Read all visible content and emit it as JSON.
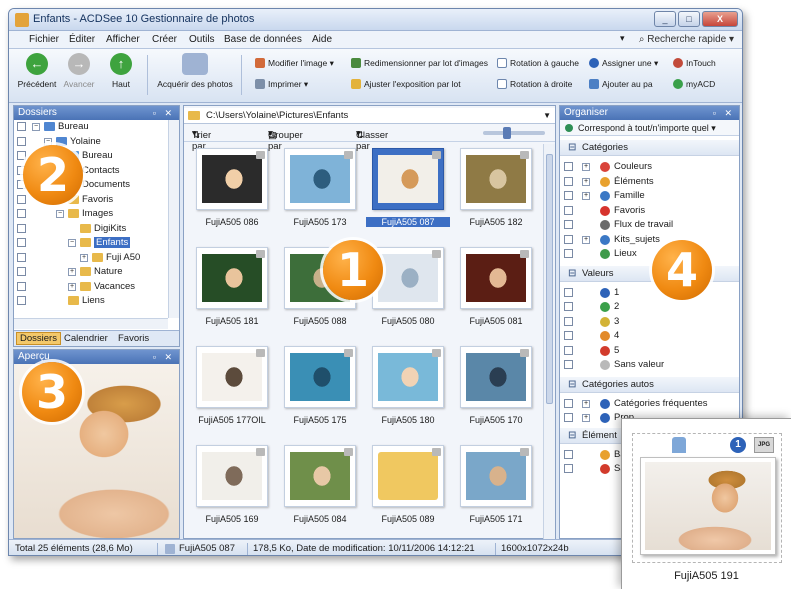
{
  "window": {
    "title": "Enfants - ACDSee 10 Gestionnaire de photos",
    "controls": [
      "_",
      "□",
      "X"
    ]
  },
  "menu": {
    "items": [
      "Fichier",
      "Éditer",
      "Afficher",
      "Créer",
      "Outils",
      "Base de données",
      "Aide"
    ],
    "quick_search": "Recherche rapide"
  },
  "toolbar": {
    "nav": [
      {
        "label": "Précédent",
        "color": "#3ea33e",
        "glyph": "←"
      },
      {
        "label": "Avancer",
        "color": "#b8b8b8",
        "glyph": "→"
      },
      {
        "label": "Haut",
        "color": "#3ea33e",
        "glyph": "↑"
      }
    ],
    "acquire": "Acquérir des photos",
    "modify": "Modifier l'image",
    "print": "Imprimer",
    "resize_batch": "Redimensionner par lot d'images",
    "adjust_exposure": "Ajuster l'exposition par lot",
    "rotate_left": "Rotation à gauche",
    "rotate_right": "Rotation à droite",
    "assign": "Assigner une",
    "add_to": "Ajouter au pa",
    "intouch": "InTouch",
    "myacd": "myACD"
  },
  "folders_pane": {
    "title": "Dossiers",
    "tree": [
      {
        "label": "Bureau",
        "level": 0,
        "expander": "−",
        "color": "#4f86d1"
      },
      {
        "label": "Yolaine",
        "level": 1,
        "expander": "−",
        "color": "#4f86d1"
      },
      {
        "label": "Bureau",
        "level": 2,
        "expander": "",
        "color": "#5a9ad8"
      },
      {
        "label": "Contacts",
        "level": 2,
        "expander": "",
        "color": "#e8b94a"
      },
      {
        "label": "Documents",
        "level": 2,
        "expander": "",
        "color": "#e8b94a"
      },
      {
        "label": "Favoris",
        "level": 2,
        "expander": "",
        "color": "#e8b94a"
      },
      {
        "label": "Images",
        "level": 2,
        "expander": "−",
        "color": "#e8b94a"
      },
      {
        "label": "DigiKits",
        "level": 3,
        "expander": "",
        "color": "#e8b94a"
      },
      {
        "label": "Enfants",
        "level": 3,
        "expander": "−",
        "color": "#e8b94a",
        "selected": true
      },
      {
        "label": "Fuji A50",
        "level": 4,
        "expander": "+",
        "color": "#e8b94a"
      },
      {
        "label": "Nature",
        "level": 3,
        "expander": "+",
        "color": "#e8b94a"
      },
      {
        "label": "Vacances",
        "level": 3,
        "expander": "+",
        "color": "#e8b94a"
      },
      {
        "label": "Liens",
        "level": 2,
        "expander": "",
        "color": "#e8b94a"
      }
    ],
    "tabs": [
      "Dossiers",
      "Calendrier",
      "Favoris"
    ]
  },
  "preview_pane": {
    "title": "Aperçu"
  },
  "browser": {
    "path": "C:\\Users\\Yolaine\\Pictures\\Enfants",
    "sort_by": "Trier par",
    "group_by": "Grouper par",
    "class_by": "Classer par",
    "thumbnails": [
      {
        "name": "FujiA505 086",
        "colors": [
          "#2b2b2b",
          "#f1cfa8"
        ]
      },
      {
        "name": "FujiA505 173",
        "colors": [
          "#7fb3d8",
          "#2d5d7e"
        ]
      },
      {
        "name": "FujiA505 087",
        "colors": [
          "#f2efe9",
          "#d59a5a"
        ],
        "selected": true
      },
      {
        "name": "FujiA505 182",
        "colors": [
          "#8f7a45",
          "#d8c5a0"
        ]
      },
      {
        "name": "FujiA505 181",
        "colors": [
          "#264d26",
          "#e9c49c"
        ]
      },
      {
        "name": "FujiA505 088",
        "colors": [
          "#3d6e3a",
          "#c7b08a"
        ]
      },
      {
        "name": "FujiA505 080",
        "colors": [
          "#dfe6ee",
          "#9bb0c4"
        ]
      },
      {
        "name": "FujiA505 081",
        "colors": [
          "#5b1e14",
          "#e3b894"
        ]
      },
      {
        "name": "FujiA505 177OIL",
        "colors": [
          "#f4f1ec",
          "#5c4b3c"
        ]
      },
      {
        "name": "FujiA505 175",
        "colors": [
          "#3a8fb5",
          "#1f4f6b"
        ]
      },
      {
        "name": "FujiA505 180",
        "colors": [
          "#79b9d9",
          "#f1d3b5"
        ]
      },
      {
        "name": "FujiA505 170",
        "colors": [
          "#5a87a8",
          "#2a3e52"
        ]
      },
      {
        "name": "FujiA505 169",
        "colors": [
          "#f1efea",
          "#7f6b5a"
        ]
      },
      {
        "name": "FujiA505 084",
        "colors": [
          "#6f8f4a",
          "#e7c8a6"
        ]
      },
      {
        "name": "FujiA505 089",
        "colors": [
          "#f0c860",
          "#2b2b2b"
        ],
        "folder": true
      },
      {
        "name": "FujiA505 171",
        "colors": [
          "#7aa7c9",
          "#d8b28c"
        ]
      }
    ]
  },
  "organiser": {
    "title": "Organiser",
    "match": "Correspond à tout/n'importe quel",
    "categories_title": "Catégories",
    "categories": [
      {
        "label": "Couleurs",
        "icon_color": "#d9433a",
        "expander": "+"
      },
      {
        "label": "Éléments",
        "icon_color": "#e8a12e",
        "expander": "+"
      },
      {
        "label": "Famille",
        "icon_color": "#3b78c5",
        "expander": "+"
      },
      {
        "label": "Favoris",
        "icon_color": "#d6332d",
        "expander": ""
      },
      {
        "label": "Flux de travail",
        "icon_color": "#6a6a6a",
        "expander": ""
      },
      {
        "label": "Kits_sujets",
        "icon_color": "#3b78c5",
        "expander": "+"
      },
      {
        "label": "Lieux",
        "icon_color": "#3f9a4b",
        "expander": ""
      }
    ],
    "values_title": "Valeurs",
    "values": [
      {
        "label": "1",
        "color": "#2d62b8"
      },
      {
        "label": "2",
        "color": "#3aa04a"
      },
      {
        "label": "3",
        "color": "#d3b336"
      },
      {
        "label": "4",
        "color": "#e28a2a"
      },
      {
        "label": "5",
        "color": "#d23b2c"
      },
      {
        "label": "Sans valeur",
        "color": "#b9b9b9"
      }
    ],
    "auto_title": "Catégories autos",
    "auto": [
      {
        "label": "Catégories fréquentes"
      },
      {
        "label": "Prop"
      }
    ],
    "elements_title": "Élément",
    "elements": [
      {
        "label": "Banc",
        "color": "#e8a12e"
      },
      {
        "label": "Sans",
        "color": "#d23b2c"
      }
    ]
  },
  "statusbar": {
    "total": "Total 25 éléments (28,6 Mo)",
    "file": "FujiA505 087",
    "info": "178,5 Ko, Date de modification: 10/11/2006 14:12:21",
    "dimensions": "1600x1072x24b"
  },
  "callouts": [
    "1",
    "2",
    "3",
    "4"
  ],
  "zoom_card": {
    "label": "FujiA505 191",
    "badge": "1",
    "format": "JPG"
  }
}
